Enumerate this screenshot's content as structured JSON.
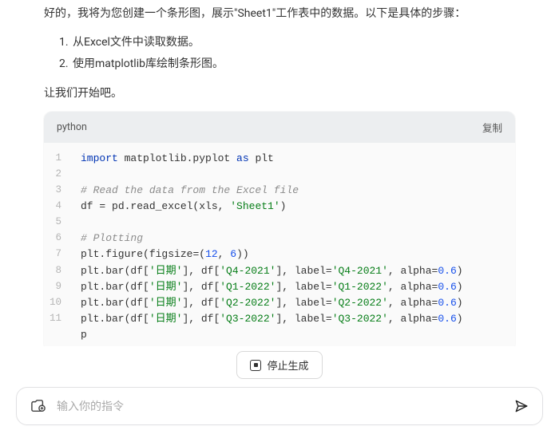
{
  "message": {
    "intro": "好的，我将为您创建一个条形图，展示\"Sheet1\"工作表中的数据。以下是具体的步骤：",
    "steps": [
      "从Excel文件中读取数据。",
      "使用matplotlib库绘制条形图。"
    ],
    "start": "让我们开始吧。"
  },
  "codeblock": {
    "lang": "python",
    "copy_label": "复制",
    "lines": [
      {
        "n": "1",
        "segments": [
          {
            "t": "import",
            "c": "k"
          },
          {
            "t": " matplotlib.pyplot ",
            "c": "id"
          },
          {
            "t": "as",
            "c": "k"
          },
          {
            "t": " plt",
            "c": "id"
          }
        ]
      },
      {
        "n": "2",
        "segments": []
      },
      {
        "n": "3",
        "segments": [
          {
            "t": "# Read the data from the Excel file",
            "c": "c"
          }
        ]
      },
      {
        "n": "4",
        "segments": [
          {
            "t": "df ",
            "c": "id"
          },
          {
            "t": "=",
            "c": "op"
          },
          {
            "t": " pd.read_excel(xls, ",
            "c": "id"
          },
          {
            "t": "'Sheet1'",
            "c": "s"
          },
          {
            "t": ")",
            "c": "p"
          }
        ]
      },
      {
        "n": "5",
        "segments": []
      },
      {
        "n": "6",
        "segments": [
          {
            "t": "# Plotting",
            "c": "c"
          }
        ]
      },
      {
        "n": "7",
        "segments": [
          {
            "t": "plt.figure(figsize",
            "c": "id"
          },
          {
            "t": "=",
            "c": "op"
          },
          {
            "t": "(",
            "c": "p"
          },
          {
            "t": "12",
            "c": "n"
          },
          {
            "t": ", ",
            "c": "p"
          },
          {
            "t": "6",
            "c": "n"
          },
          {
            "t": "))",
            "c": "p"
          }
        ]
      },
      {
        "n": "8",
        "segments": [
          {
            "t": "plt.bar(df[",
            "c": "id"
          },
          {
            "t": "'日期'",
            "c": "s"
          },
          {
            "t": "], df[",
            "c": "id"
          },
          {
            "t": "'Q4-2021'",
            "c": "s"
          },
          {
            "t": "], label",
            "c": "id"
          },
          {
            "t": "=",
            "c": "op"
          },
          {
            "t": "'Q4-2021'",
            "c": "s"
          },
          {
            "t": ", alpha",
            "c": "id"
          },
          {
            "t": "=",
            "c": "op"
          },
          {
            "t": "0.6",
            "c": "n"
          },
          {
            "t": ")",
            "c": "p"
          }
        ]
      },
      {
        "n": "9",
        "segments": [
          {
            "t": "plt.bar(df[",
            "c": "id"
          },
          {
            "t": "'日期'",
            "c": "s"
          },
          {
            "t": "], df[",
            "c": "id"
          },
          {
            "t": "'Q1-2022'",
            "c": "s"
          },
          {
            "t": "], label",
            "c": "id"
          },
          {
            "t": "=",
            "c": "op"
          },
          {
            "t": "'Q1-2022'",
            "c": "s"
          },
          {
            "t": ", alpha",
            "c": "id"
          },
          {
            "t": "=",
            "c": "op"
          },
          {
            "t": "0.6",
            "c": "n"
          },
          {
            "t": ")",
            "c": "p"
          }
        ]
      },
      {
        "n": "10",
        "segments": [
          {
            "t": "plt.bar(df[",
            "c": "id"
          },
          {
            "t": "'日期'",
            "c": "s"
          },
          {
            "t": "], df[",
            "c": "id"
          },
          {
            "t": "'Q2-2022'",
            "c": "s"
          },
          {
            "t": "], label",
            "c": "id"
          },
          {
            "t": "=",
            "c": "op"
          },
          {
            "t": "'Q2-2022'",
            "c": "s"
          },
          {
            "t": ", alpha",
            "c": "id"
          },
          {
            "t": "=",
            "c": "op"
          },
          {
            "t": "0.6",
            "c": "n"
          },
          {
            "t": ")",
            "c": "p"
          }
        ]
      },
      {
        "n": "11",
        "segments": [
          {
            "t": "plt.bar(df[",
            "c": "id"
          },
          {
            "t": "'日期'",
            "c": "s"
          },
          {
            "t": "], df[",
            "c": "id"
          },
          {
            "t": "'Q3-2022'",
            "c": "s"
          },
          {
            "t": "], label",
            "c": "id"
          },
          {
            "t": "=",
            "c": "op"
          },
          {
            "t": "'Q3-2022'",
            "c": "s"
          },
          {
            "t": ", alpha",
            "c": "id"
          },
          {
            "t": "=",
            "c": "op"
          },
          {
            "t": "0.6",
            "c": "n"
          },
          {
            "t": ")",
            "c": "p"
          }
        ]
      },
      {
        "n": "",
        "segments": [
          {
            "t": "p",
            "c": "id"
          }
        ]
      }
    ]
  },
  "controls": {
    "stop_label": "停止生成",
    "input_placeholder": "输入你的指令"
  }
}
